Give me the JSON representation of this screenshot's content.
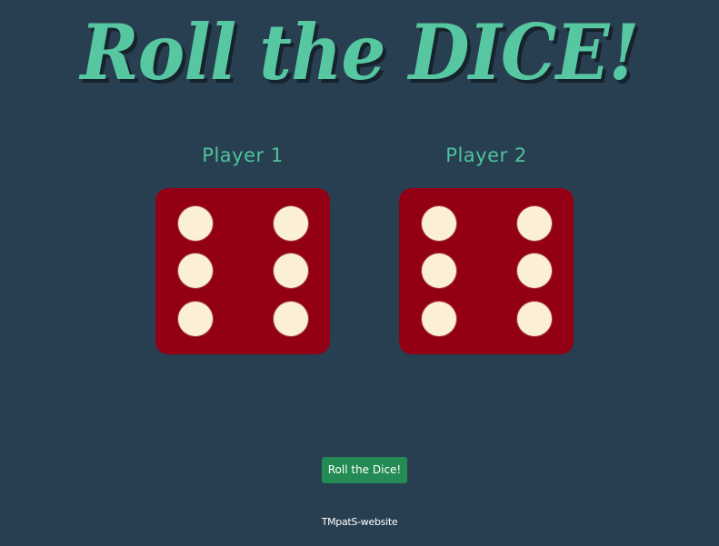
{
  "header": {
    "title": "Roll the DICE!"
  },
  "players": [
    {
      "label": "Player 1",
      "die_value": 6
    },
    {
      "label": "Player 2",
      "die_value": 6
    }
  ],
  "actions": {
    "roll_label": "Roll the Dice!"
  },
  "footer": {
    "text": "TMpatS-website"
  },
  "colors": {
    "background": "#283f51",
    "title": "#56c7a0",
    "player_label": "#4ec39b",
    "die": "#930015",
    "pip": "#fbf0d6",
    "button": "#238b53"
  }
}
